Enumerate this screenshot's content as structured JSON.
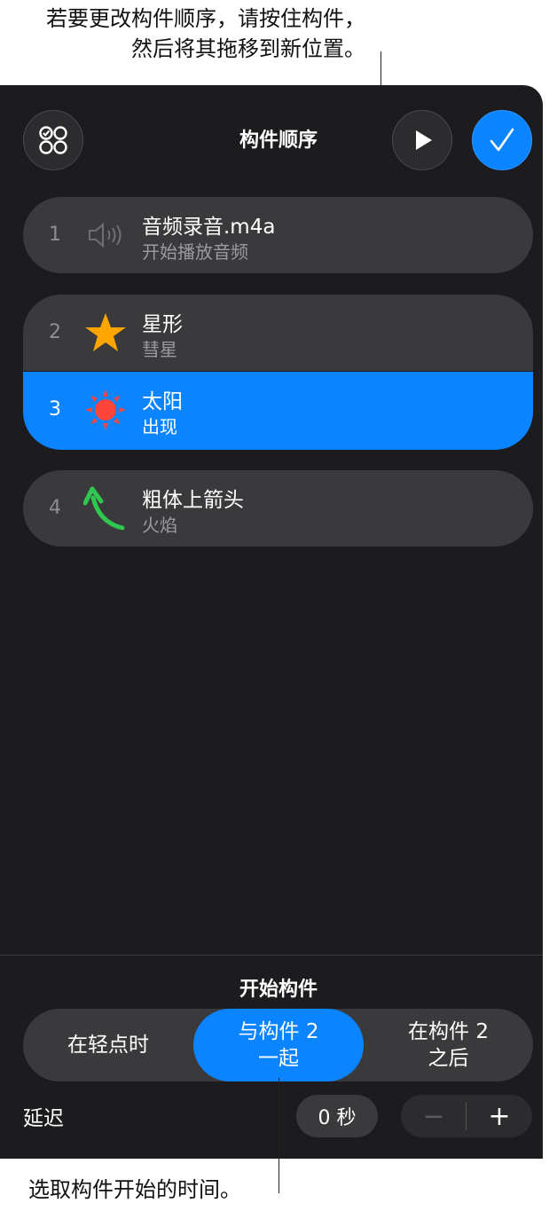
{
  "callouts": {
    "top_line1": "若要更改构件顺序，请按住构件，",
    "top_line2": "然后将其拖移到新位置。",
    "bottom": "选取构件开始的时间。"
  },
  "header": {
    "title": "构件顺序",
    "builds_button_icon": "four-circles-icon",
    "play_button_icon": "play-icon",
    "done_button_icon": "checkmark-icon"
  },
  "builds": [
    {
      "num": "1",
      "title": "音频录音.m4a",
      "subtitle": "开始播放音频",
      "icon": "speaker-icon"
    },
    {
      "num": "2",
      "title": "星形",
      "subtitle": "彗星",
      "icon": "star-icon"
    },
    {
      "num": "3",
      "title": "太阳",
      "subtitle": "出现",
      "icon": "sun-icon",
      "selected": true
    },
    {
      "num": "4",
      "title": "粗体上箭头",
      "subtitle": "火焰",
      "icon": "curved-arrow-icon"
    }
  ],
  "start": {
    "section_title": "开始构件",
    "options": [
      {
        "line1": "在轻点时",
        "line2": ""
      },
      {
        "line1": "与构件 2",
        "line2": "一起"
      },
      {
        "line1": "在构件 2",
        "line2": "之后"
      }
    ],
    "selected_index": 1,
    "delay_label": "延迟",
    "delay_value": "0 秒",
    "minus": "−",
    "plus": "+"
  },
  "colors": {
    "panel_bg": "#1c1c1e",
    "row_bg": "#3a3a3c",
    "accent": "#0a84ff",
    "star": "#ffa500",
    "sun": "#ff453a",
    "arrow": "#30c750"
  }
}
